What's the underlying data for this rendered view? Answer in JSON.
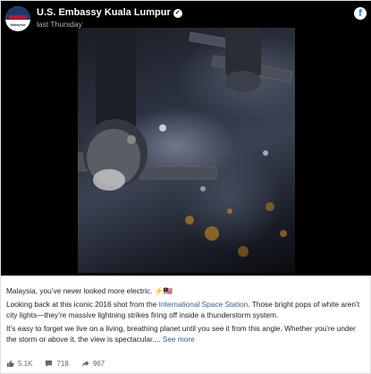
{
  "post": {
    "page_name": "U.S. Embassy Kuala Lumpur",
    "timestamp": "last Thursday",
    "avatar_text": "Malaysia",
    "platform_logo": "f"
  },
  "caption": {
    "line1": "Malaysia, you’ve never looked more electric. ⚡🇲🇾",
    "p2_before": "Looking back at this iconic 2016 shot from the ",
    "p2_link": "International Space Station",
    "p2_after": ". Those bright pops of white aren’t city lights—they’re massive lightning strikes firing off inside a thunderstorm system.",
    "p3": "It’s easy to forget we live on a living, breathing planet until you see it from this angle. Whether you’re under the storm or above it, the view is spectacular.... ",
    "see_more": "See more"
  },
  "stats": {
    "likes": "5.1K",
    "comments": "718",
    "shares": "967"
  },
  "icons": {
    "likes": "thumbs-up-icon",
    "comments": "comment-icon",
    "shares": "share-icon",
    "verified": "verified-badge-icon",
    "logo": "facebook-logo-icon"
  },
  "colors": {
    "link": "#385898",
    "media_bg": "#000000",
    "text": "#1c1e21",
    "muted": "#606770"
  }
}
